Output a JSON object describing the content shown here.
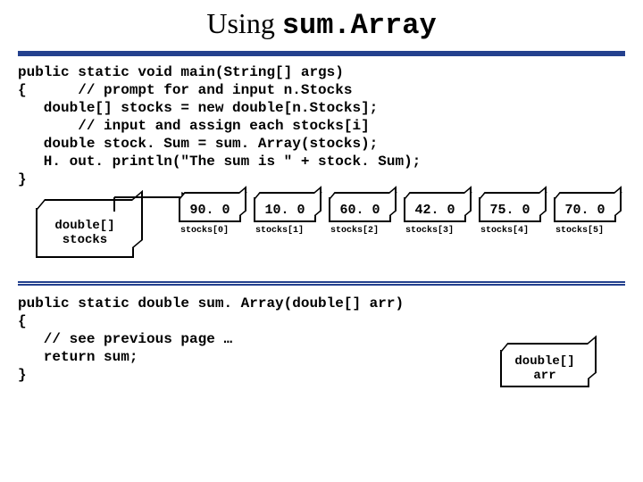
{
  "title": {
    "prefix": "Using ",
    "mono": "sum.Array"
  },
  "code1": "public static void main(String[] args)\n{      // prompt for and input n.Stocks\n   double[] stocks = new double[n.Stocks];\n       // input and assign each stocks[i]\n   double stock. Sum = sum. Array(stocks);\n   H. out. println(\"The sum is \" + stock. Sum);\n}",
  "var_box_label": "double[]\nstocks",
  "cells": [
    {
      "value": "90. 0",
      "label": "stocks[0]"
    },
    {
      "value": "10. 0",
      "label": "stocks[1]"
    },
    {
      "value": "60. 0",
      "label": "stocks[2]"
    },
    {
      "value": "42. 0",
      "label": "stocks[3]"
    },
    {
      "value": "75. 0",
      "label": "stocks[4]"
    },
    {
      "value": "70. 0",
      "label": "stocks[5]"
    }
  ],
  "code2": "public static double sum. Array(double[] arr)\n{\n   // see previous page …\n   return sum;\n}",
  "arr_box_label": "double[]\narr"
}
